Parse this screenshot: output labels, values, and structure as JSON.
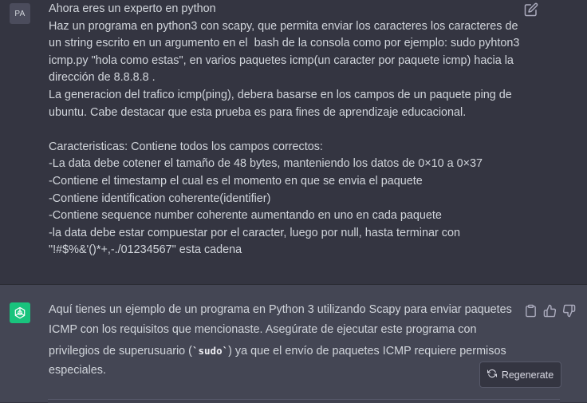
{
  "user_message": {
    "avatar_initials": "PA",
    "lines": [
      "Ahora eres un experto en python",
      "Haz un programa en python3 con scapy, que permita enviar los caracteres los caracteres de",
      "un string escrito en un argumento en el  bash de la consola como por ejemplo: sudo pyhton3",
      "icmp.py \"hola como estas\", en varios paquetes icmp(un caracter por paquete icmp) hacia la",
      "dirección de 8.8.8.8 .",
      "La generacion del trafico icmp(ping), debera basarse en los campos de un paquete ping de",
      "ubuntu. Cabe destacar que esta prueba es para fines de aprendizaje educacional.",
      "",
      "Caracteristicas: Contiene todos los campos correctos:",
      "-La data debe cotener el tamaño de 48 bytes, manteniendo los datos de 0×10 a 0×37",
      "-Contiene el timestamp el cual es el momento en que se envia el paquete",
      "-Contiene identification coherente(identifier)",
      "-Contiene sequence number coherente aumentando en uno en cada paquete",
      "-la data debe estar compuestar por el caracter, luego por null, hasta terminar con",
      "\"!#$%&'()*+,-./01234567\" esta cadena"
    ],
    "edit_icon": "pencil-square-icon"
  },
  "assistant_message": {
    "line1": "Aquí tienes un ejemplo de un programa en Python 3 utilizando Scapy para enviar paquetes",
    "line2": "ICMP con los requisitos que mencionaste. Asegúrate de ejecutar este programa con",
    "line3_before": "privilegios de superusuario (",
    "line3_code": "`sudo`",
    "line3_after": ") ya que el envío de paquetes ICMP requiere permisos",
    "line4": "especiales.",
    "icons": [
      "clipboard-icon",
      "thumbs-up-icon",
      "thumbs-down-icon"
    ]
  },
  "regenerate": {
    "label": "Regenerate",
    "icon": "refresh-icon"
  },
  "colors": {
    "user_bg": "#343541",
    "assistant_bg": "#444654",
    "bot_avatar": "#19c37d",
    "text": "#d1d5db"
  }
}
